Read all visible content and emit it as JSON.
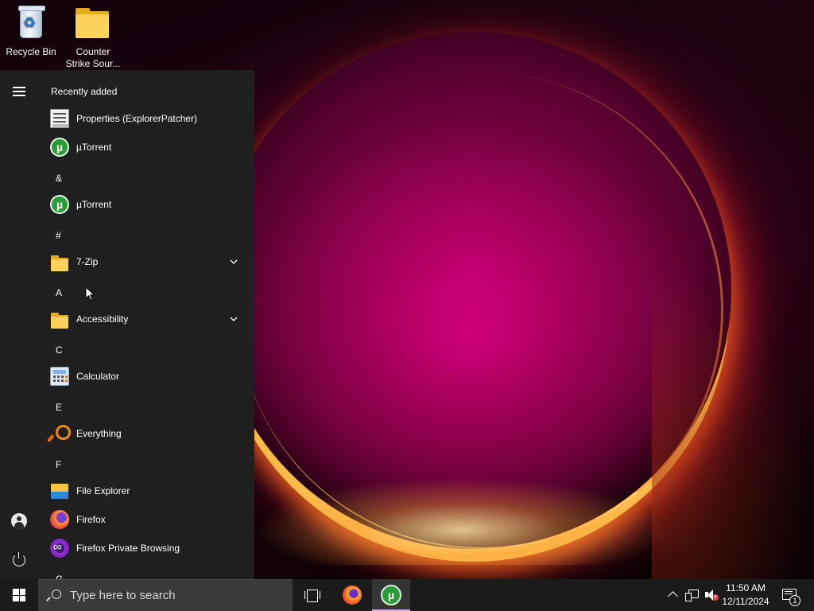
{
  "desktop": {
    "icons": [
      {
        "label": "Recycle Bin",
        "icon": "recycle-bin-icon"
      },
      {
        "label": "Counter\nStrike Sour...",
        "icon": "folder-icon"
      }
    ]
  },
  "start_menu": {
    "rail": {
      "menu_icon": "hamburger-icon",
      "account_icon": "user-avatar-icon",
      "power_icon": "power-icon"
    },
    "recently_added_header": "Recently added",
    "recent_items": [
      {
        "label": "Properties (ExplorerPatcher)",
        "icon": "properties-icon"
      },
      {
        "label": "µTorrent",
        "icon": "utorrent-icon"
      }
    ],
    "groups": [
      {
        "letter": "&",
        "items": [
          {
            "label": "µTorrent",
            "icon": "utorrent-icon",
            "expandable": false
          }
        ]
      },
      {
        "letter": "#",
        "items": [
          {
            "label": "7-Zip",
            "icon": "folder-icon",
            "expandable": true
          }
        ]
      },
      {
        "letter": "A",
        "items": [
          {
            "label": "Accessibility",
            "icon": "folder-icon",
            "expandable": true
          }
        ]
      },
      {
        "letter": "C",
        "items": [
          {
            "label": "Calculator",
            "icon": "calculator-icon",
            "expandable": false
          }
        ]
      },
      {
        "letter": "E",
        "items": [
          {
            "label": "Everything",
            "icon": "everything-search-icon",
            "expandable": false
          }
        ]
      },
      {
        "letter": "F",
        "items": [
          {
            "label": "File Explorer",
            "icon": "file-explorer-icon",
            "expandable": false
          },
          {
            "label": "Firefox",
            "icon": "firefox-icon",
            "expandable": false
          },
          {
            "label": "Firefox Private Browsing",
            "icon": "firefox-private-icon",
            "expandable": false
          }
        ]
      },
      {
        "letter": "G",
        "items": []
      }
    ]
  },
  "taskbar": {
    "start_icon": "windows-logo-icon",
    "search_placeholder": "Type here to search",
    "pinned": [
      {
        "name": "task-view",
        "icon": "task-view-icon"
      },
      {
        "name": "firefox",
        "icon": "firefox-icon"
      },
      {
        "name": "utorrent",
        "icon": "utorrent-icon",
        "active": true
      }
    ],
    "tray": {
      "overflow_icon": "chevron-up-icon",
      "network_icon": "network-icon",
      "volume_icon": "volume-muted-icon",
      "time": "11:50 AM",
      "date": "12/11/2024",
      "notifications_count": "1",
      "notification_icon": "action-center-icon"
    }
  },
  "colors": {
    "start_bg": "#1f1f1f",
    "taskbar_bg": "#1b1b1b",
    "search_bg": "#3a3a3a",
    "active_indicator": "#c9a3f0"
  }
}
